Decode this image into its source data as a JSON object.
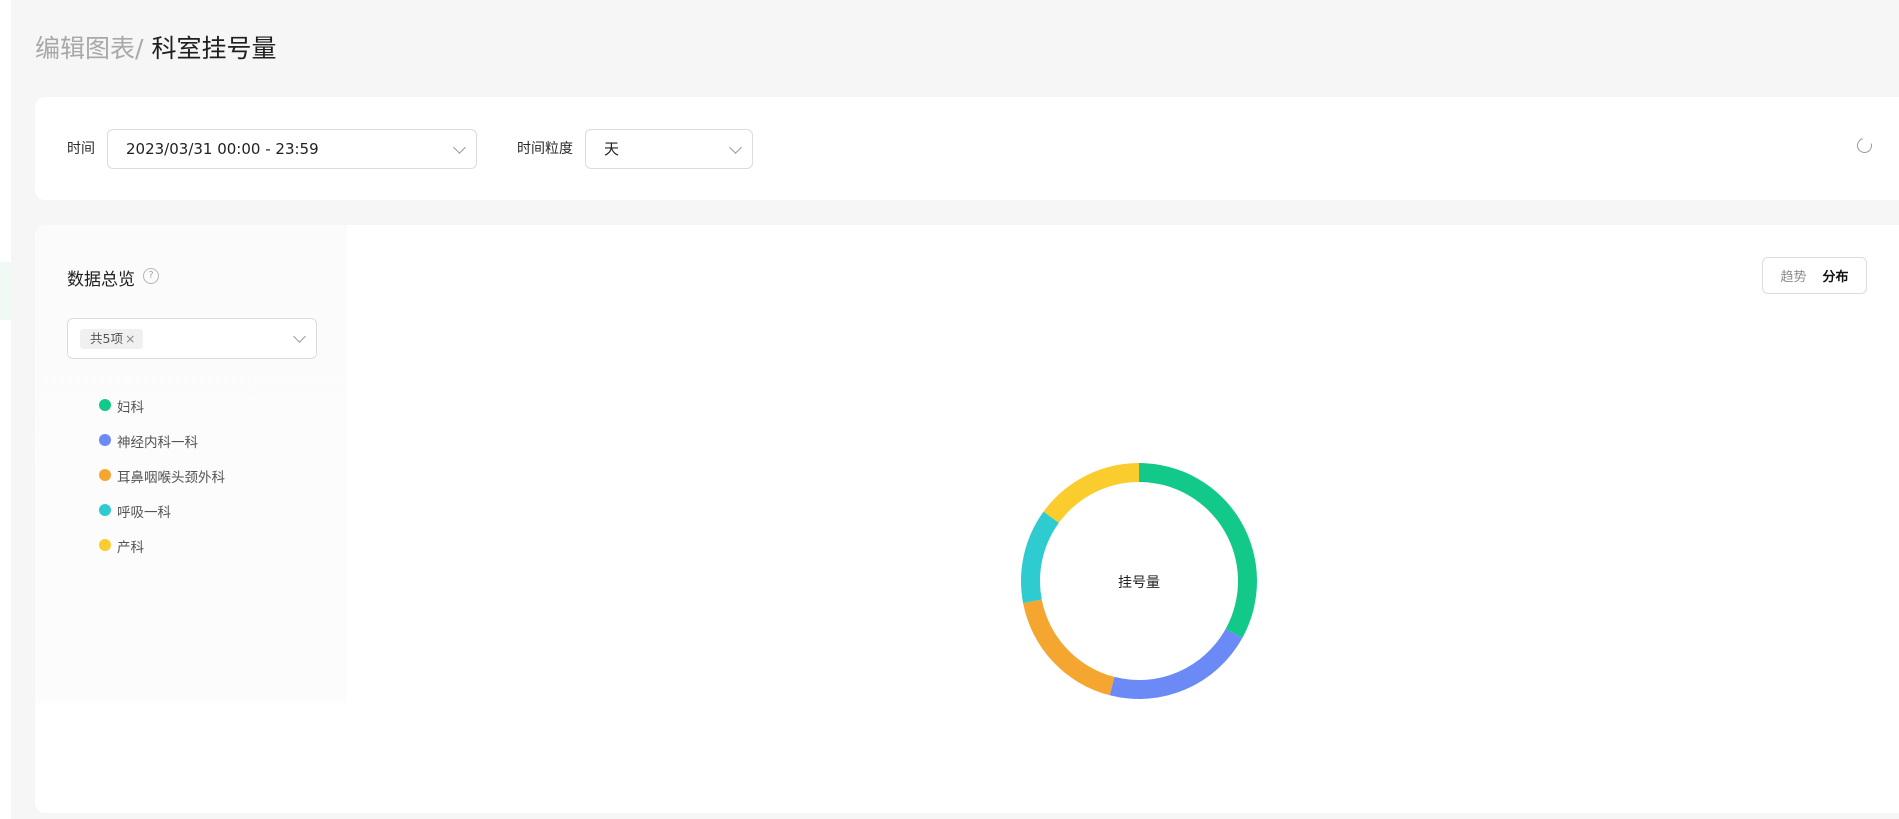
{
  "breadcrumb": {
    "parent": "编辑图表/",
    "current": "科室挂号量"
  },
  "filters": {
    "time_label": "时间",
    "time_value": "2023/03/31 00:00 - 23:59",
    "granularity_label": "时间粒度",
    "granularity_value": "天"
  },
  "overview": {
    "title": "数据总览",
    "help_icon": "?",
    "select_tag": "共5项",
    "tag_close": "×"
  },
  "view_toggle": {
    "trend": "趋势",
    "distribution": "分布",
    "active": "distribution"
  },
  "chart_data": {
    "type": "pie",
    "donut": true,
    "center_label": "挂号量",
    "slices": [
      {
        "name": "妇科",
        "color": "#13c98a",
        "value": 33
      },
      {
        "name": "神经内科一科",
        "color": "#6b8af6",
        "value": 21
      },
      {
        "name": "耳鼻咽喉头颈外科",
        "color": "#f5a631",
        "value": 18
      },
      {
        "name": "呼吸一科",
        "color": "#2ecbd0",
        "value": 13
      },
      {
        "name": "产科",
        "color": "#facc2e",
        "value": 15
      }
    ]
  }
}
